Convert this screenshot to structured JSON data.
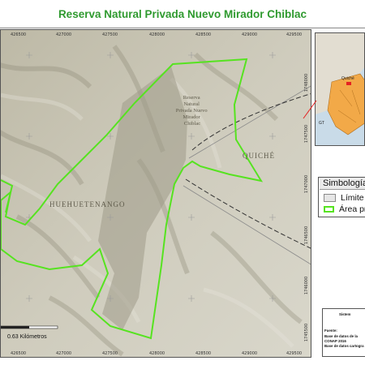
{
  "title": "Reserva Natural Privada Nuevo Mirador Chiblac",
  "map": {
    "area_label_lines": [
      "Reserva",
      "Natural",
      "Privada Nuevo",
      "Mirador",
      "Chiblac"
    ],
    "region_labels": {
      "west": "HUEHUETENANGO",
      "east": "QUICHÉ"
    },
    "scale_label": "0.63 Kilómetros",
    "x_ticks_top": [
      "426500",
      "427000",
      "427500",
      "428000",
      "428500",
      "429000",
      "429500"
    ],
    "x_ticks_bottom": [
      "426500",
      "427000",
      "427500",
      "428000",
      "428500",
      "429000",
      "429500"
    ],
    "y_ticks_right": [
      "1748000",
      "1747500",
      "1747000",
      "1746500",
      "1746000",
      "1745500"
    ],
    "colors": {
      "boundary": "#56e320",
      "terrain": "#c9c6b5",
      "limit_line": "#8a8a8a"
    }
  },
  "inset": {
    "labels": [
      "Quiché"
    ],
    "country_code": "GT"
  },
  "legend": {
    "title": "Simbología",
    "items": [
      {
        "label": "Límite",
        "swatch": "gray"
      },
      {
        "label": "Área pr",
        "swatch": "green"
      }
    ]
  },
  "info": {
    "title": "Sistem",
    "source_label": "Fuente:",
    "lines": [
      "Base de datos de la",
      "CONAP 2016",
      "Base de datos cartogra"
    ]
  }
}
